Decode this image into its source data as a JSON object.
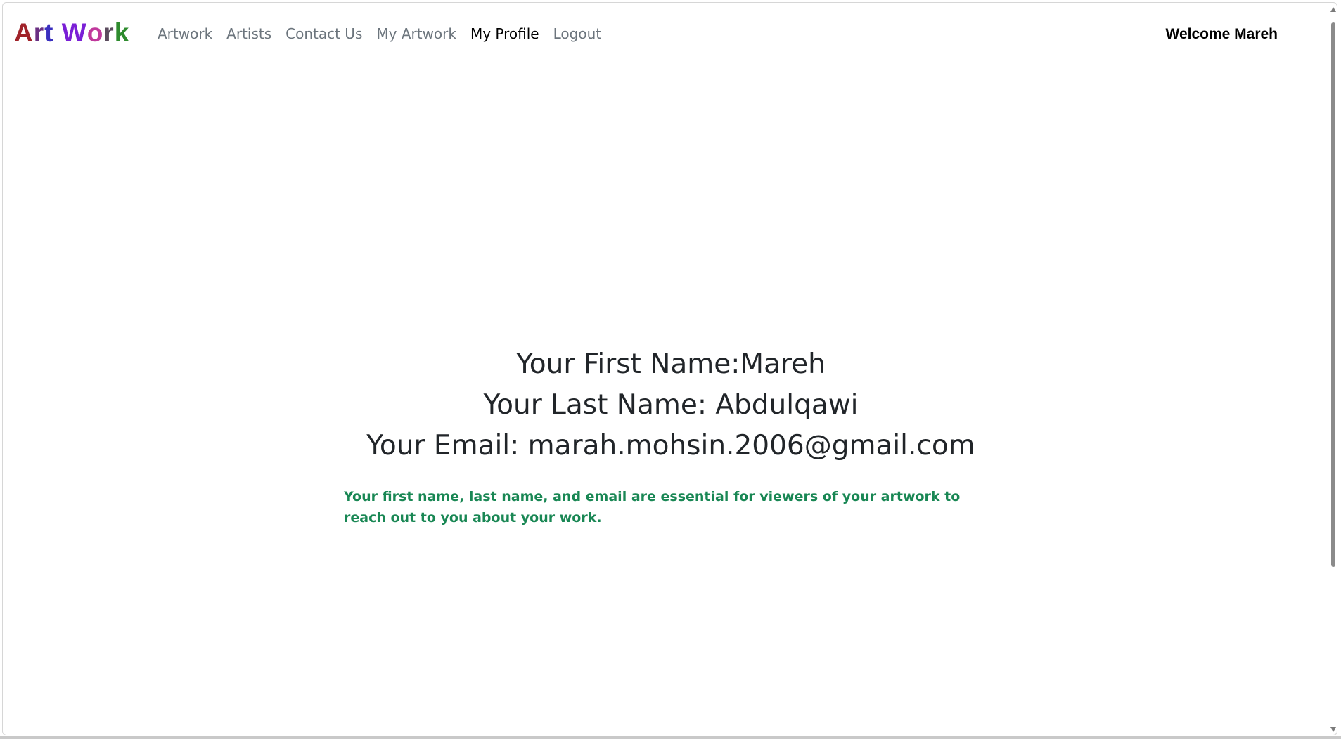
{
  "brand": {
    "letters": [
      {
        "char": "A",
        "color": "#a0232a"
      },
      {
        "char": "r",
        "color": "#6a2f82"
      },
      {
        "char": "t",
        "color": "#3a2fbf"
      },
      {
        "char": " ",
        "color": "#000000"
      },
      {
        "char": "W",
        "color": "#7a1fd6"
      },
      {
        "char": "o",
        "color": "#c0399c"
      },
      {
        "char": "r",
        "color": "#5b4b5e"
      },
      {
        "char": "k",
        "color": "#2e8b2e"
      }
    ]
  },
  "nav": {
    "items": [
      {
        "label": "Artwork",
        "active": false
      },
      {
        "label": "Artists",
        "active": false
      },
      {
        "label": "Contact Us",
        "active": false
      },
      {
        "label": "My Artwork",
        "active": false
      },
      {
        "label": "My Profile",
        "active": true
      },
      {
        "label": "Logout",
        "active": false
      }
    ],
    "welcome": "Welcome Mareh"
  },
  "profile": {
    "first_name_line": "Your First Name:Mareh",
    "last_name_line": "Your Last Name: Abdulqawi",
    "email_line": "Your Email: marah.mohsin.2006@gmail.com",
    "note": "Your first name, last name, and email are essential for viewers of your artwork to reach out to you about your work.",
    "note_color": "#198754"
  }
}
